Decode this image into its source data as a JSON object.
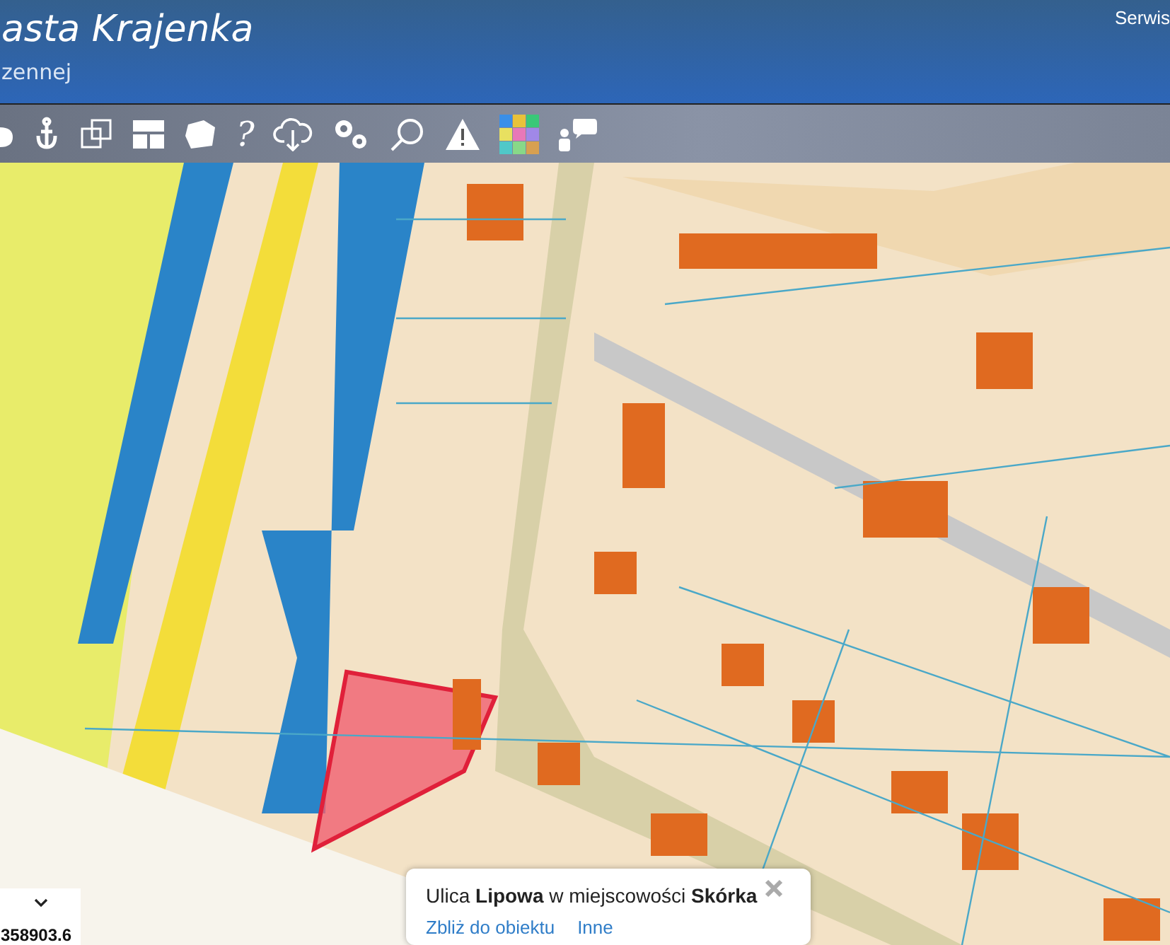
{
  "header": {
    "title": "asta Krajenka",
    "subtitle": "zennej",
    "link": "Serwis"
  },
  "toolbar": {
    "help_glyph": "?"
  },
  "coordinates": {
    "value": "358903.6"
  },
  "popup": {
    "text": "Ulica **Lipowa** w miejscowości **Skórka**",
    "links": [
      "Zbliż do obiektu",
      "Inne"
    ]
  }
}
